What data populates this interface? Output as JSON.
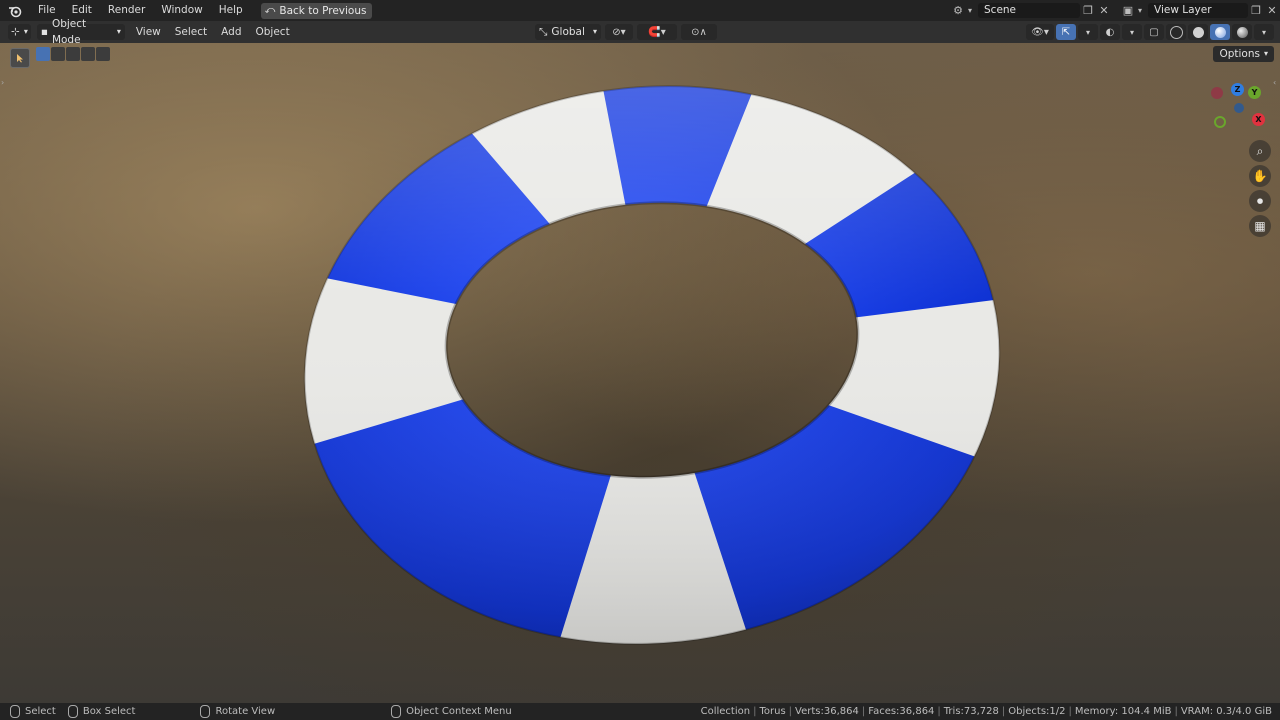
{
  "topbar": {
    "menus": [
      "File",
      "Edit",
      "Render",
      "Window",
      "Help"
    ],
    "back_button": "Back to Previous",
    "scene": "Scene",
    "view_layer": "View Layer"
  },
  "header": {
    "mode": "Object Mode",
    "menus": [
      "View",
      "Select",
      "Add",
      "Object"
    ],
    "orientation": "Global"
  },
  "viewport": {
    "options_label": "Options",
    "gizmo_axes": {
      "z": "Z",
      "y": "Y",
      "x": "X"
    },
    "torus_colors": {
      "blue": "#0a2fd6",
      "white": "#e9e9e6"
    }
  },
  "statusbar": {
    "select": "Select",
    "box_select": "Box Select",
    "rotate_view": "Rotate View",
    "context_menu": "Object Context Menu",
    "stats": {
      "collection": "Collection",
      "object": "Torus",
      "verts": "Verts:36,864",
      "faces": "Faces:36,864",
      "tris": "Tris:73,728",
      "objects": "Objects:1/2",
      "memory": "Memory: 104.4 MiB",
      "vram": "VRAM: 0.3/4.0 GiB"
    }
  }
}
